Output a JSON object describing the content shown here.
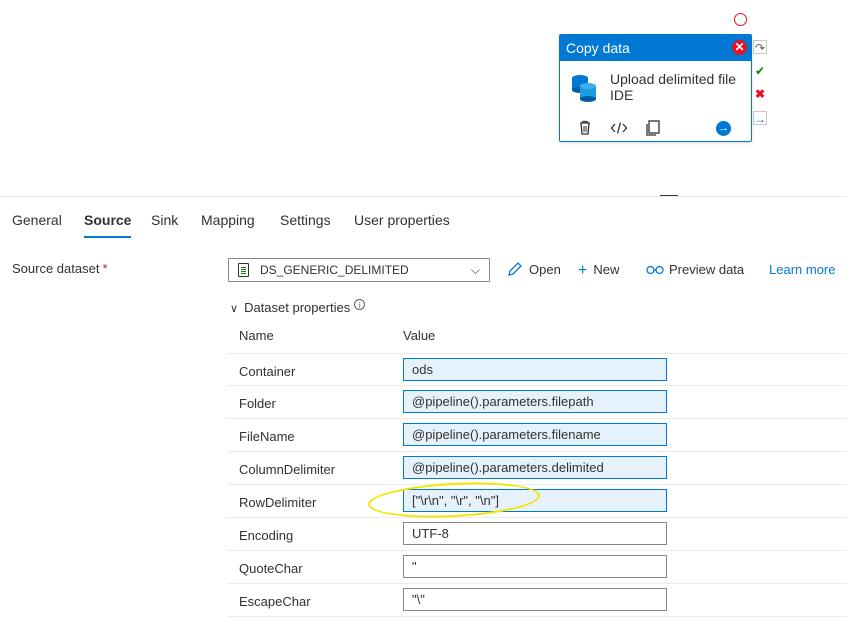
{
  "activity": {
    "type_label": "Copy data",
    "name": "Upload delimited file IDE",
    "close_glyph": "✕",
    "go_glyph": "→"
  },
  "tabs": [
    {
      "label": "General"
    },
    {
      "label": "Source",
      "active": true
    },
    {
      "label": "Sink"
    },
    {
      "label": "Mapping"
    },
    {
      "label": "Settings"
    },
    {
      "label": "User properties"
    }
  ],
  "source": {
    "label": "Source dataset",
    "required_mark": "*",
    "dataset_value": "DS_GENERIC_DELIMITED",
    "open_label": "Open",
    "new_label": "New",
    "preview_label": "Preview data",
    "learn_more_label": "Learn more"
  },
  "dataset_properties": {
    "header": "Dataset properties",
    "col_name": "Name",
    "col_value": "Value",
    "rows": [
      {
        "name": "Container",
        "value": "ods",
        "dynamic": true
      },
      {
        "name": "Folder",
        "value": "@pipeline().parameters.filepath",
        "dynamic": true
      },
      {
        "name": "FileName",
        "value": "@pipeline().parameters.filename",
        "dynamic": true
      },
      {
        "name": "ColumnDelimiter",
        "value": "@pipeline().parameters.delimited",
        "dynamic": true
      },
      {
        "name": "RowDelimiter",
        "value": "[\"\\r\\n\", \"\\r\", \"\\n\"]",
        "dynamic": true
      },
      {
        "name": "Encoding",
        "value": "UTF-8",
        "dynamic": false
      },
      {
        "name": "QuoteChar",
        "value": "\"",
        "dynamic": false
      },
      {
        "name": "EscapeChar",
        "value": "\"\\\"",
        "dynamic": false
      }
    ]
  },
  "colors": {
    "accent": "#0078d4",
    "danger": "#e81123",
    "success": "#107c10",
    "highlight": "#f2e500",
    "dynamic_field_bg": "#e6f2fb"
  },
  "icons": {
    "card": [
      "database-icon",
      "delete-icon",
      "code-icon",
      "copy-icon",
      "go-arrow-icon"
    ],
    "side": [
      "redo-icon",
      "success-check-icon",
      "failure-x-icon",
      "completion-arrow-icon"
    ],
    "toolbar": [
      "edit-pencil-icon",
      "plus-icon",
      "glasses-icon",
      "external-link-icon"
    ]
  }
}
